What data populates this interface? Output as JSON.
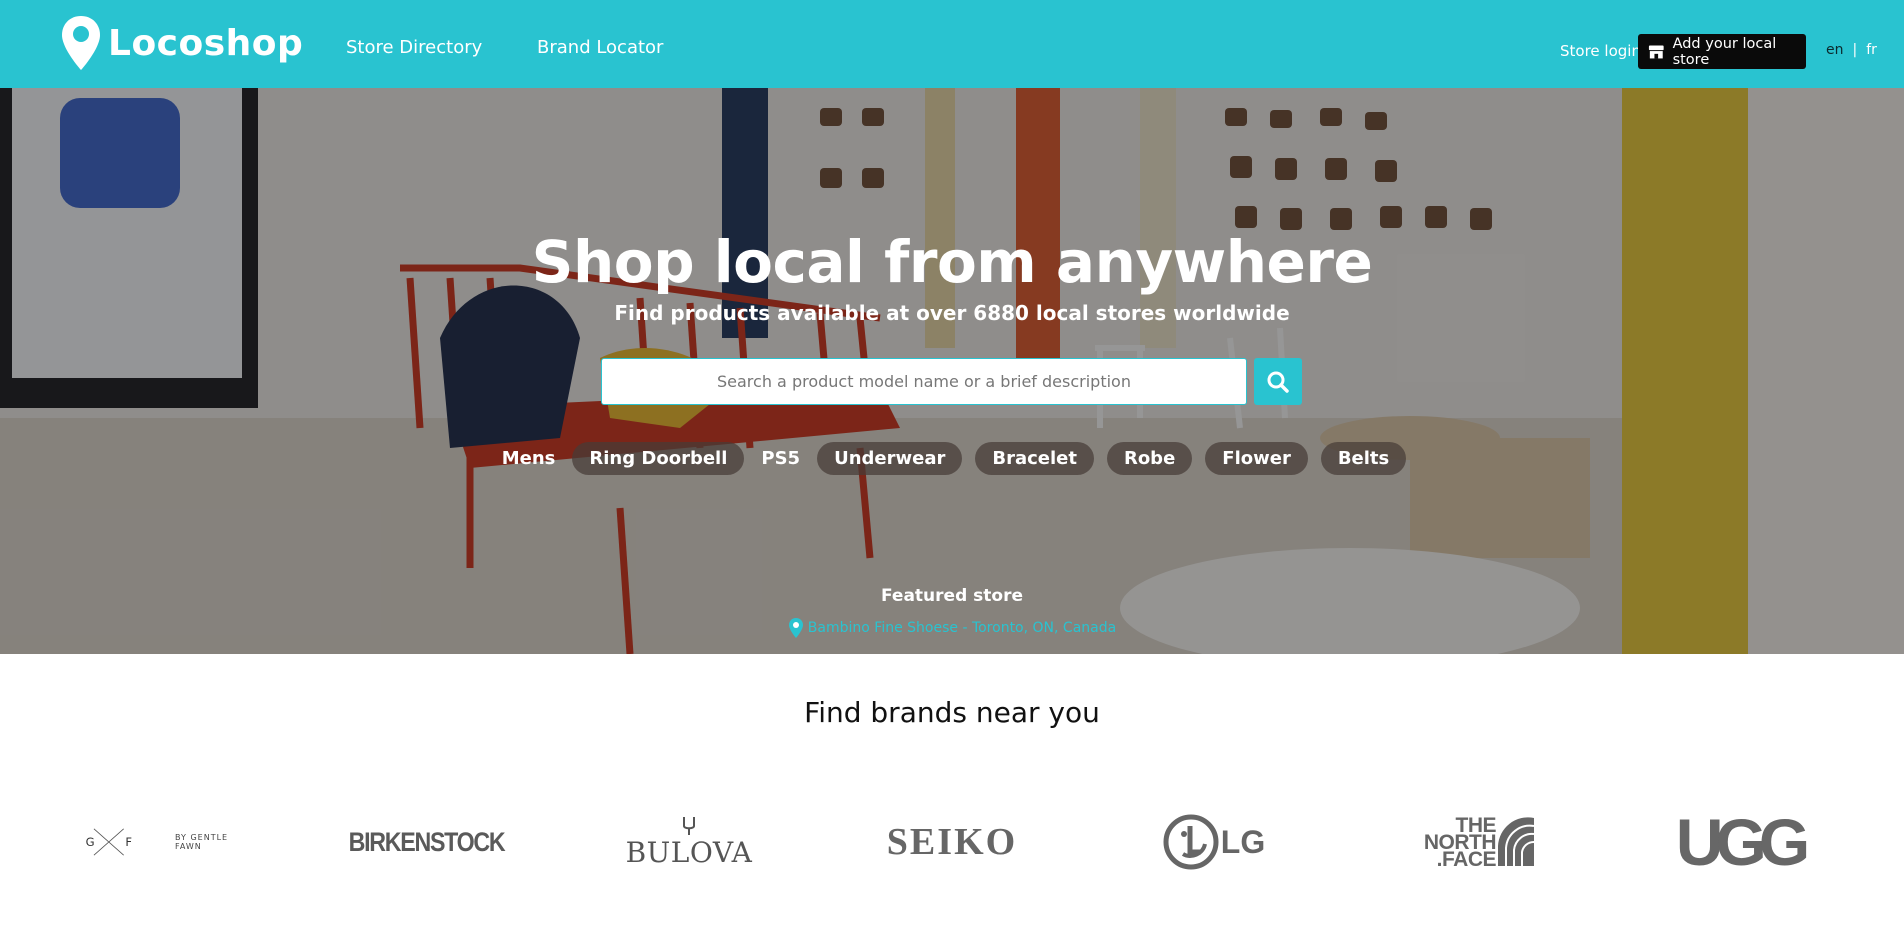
{
  "header": {
    "logo_text": "Locoshop",
    "nav": [
      {
        "label": "Store Directory"
      },
      {
        "label": "Brand Locator"
      }
    ],
    "store_login": "Store login",
    "add_store_label": "Add your local store",
    "languages": {
      "en": "en",
      "separator": "|",
      "fr": "fr",
      "active": "en"
    }
  },
  "hero": {
    "title": "Shop local from anywhere",
    "subtitle": "Find products available at over 6880 local stores worldwide",
    "search": {
      "placeholder": "Search a product model name or a brief description",
      "value": ""
    },
    "chips": [
      {
        "label": "Mens"
      },
      {
        "label": "Ring Doorbell"
      },
      {
        "label": "PS5"
      },
      {
        "label": "Underwear"
      },
      {
        "label": "Bracelet"
      },
      {
        "label": "Robe"
      },
      {
        "label": "Flower"
      },
      {
        "label": "Belts"
      }
    ],
    "featured_label": "Featured store",
    "featured_store": "Bambino Fine Shoese - Toronto, ON, Canada"
  },
  "brands": {
    "title": "Find brands near you",
    "items": [
      {
        "name": "GF",
        "logo_text": "G F",
        "logo_subtext": "BY GENTLE FAWN"
      },
      {
        "name": "Birkenstock",
        "logo_text": "BIRKENSTOCK"
      },
      {
        "name": "Bulova",
        "logo_text": "BULOVA"
      },
      {
        "name": "Seiko",
        "logo_text": "SEIKO"
      },
      {
        "name": "LG",
        "logo_text": "LG"
      },
      {
        "name": "The North Face",
        "logo_text": "THE NORTH .FACE"
      },
      {
        "name": "UGG",
        "logo_text": "UGG"
      }
    ]
  },
  "colors": {
    "brand_teal": "#29c3d0",
    "button_dark": "#0a0a0a",
    "chip_bg": "rgba(70,60,55,0.72)"
  },
  "icons": [
    "location-pin-icon",
    "store-icon",
    "search-icon",
    "map-pin-icon"
  ]
}
